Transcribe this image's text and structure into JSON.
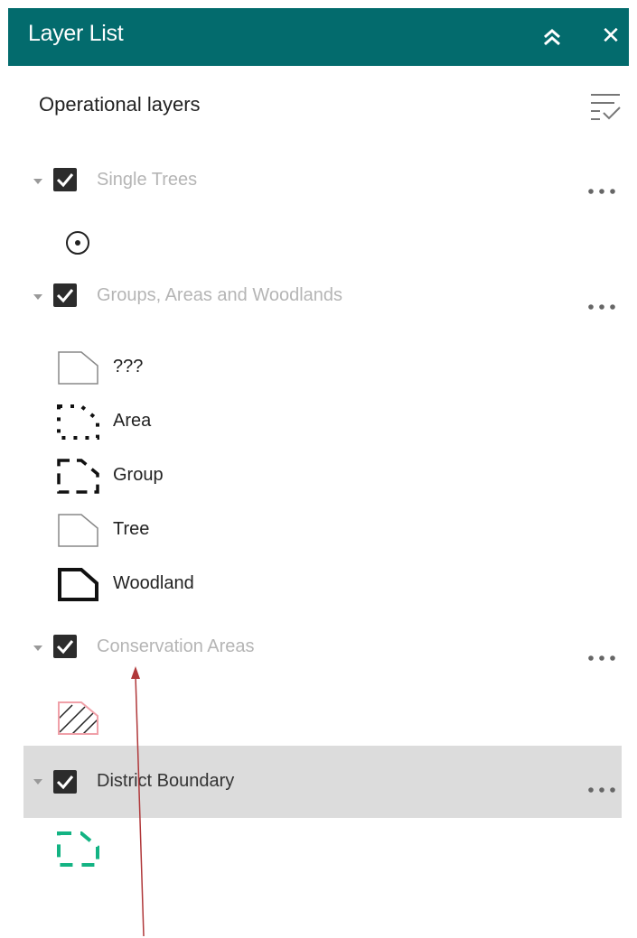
{
  "header": {
    "title": "Layer List",
    "collapse_icon": "double-chevron-up-icon",
    "close_icon": "close-icon",
    "close_glyph": "✕",
    "background": "#036b6d"
  },
  "section": {
    "title": "Operational layers",
    "tools_icon": "layer-list-options-icon"
  },
  "layers": [
    {
      "label": "Single Trees",
      "checked": true,
      "legend": [
        {
          "label": "",
          "icon": "point-circle-icon"
        }
      ]
    },
    {
      "label": "Groups, Areas and Woodlands",
      "checked": true,
      "legend": [
        {
          "label": "???",
          "icon": "polygon-thin-gray-icon"
        },
        {
          "label": "Area",
          "icon": "polygon-dotted-black-icon"
        },
        {
          "label": "Group",
          "icon": "polygon-dashed-black-icon"
        },
        {
          "label": "Tree",
          "icon": "polygon-thin-gray-icon"
        },
        {
          "label": "Woodland",
          "icon": "polygon-thick-black-icon"
        }
      ]
    },
    {
      "label": "Conservation Areas",
      "checked": true,
      "legend": [
        {
          "label": "",
          "icon": "polygon-hatched-pink-icon"
        }
      ]
    },
    {
      "label": "District Boundary",
      "checked": true,
      "selected": true,
      "legend": [
        {
          "label": "",
          "icon": "polygon-dashed-teal-icon"
        }
      ]
    }
  ],
  "colors": {
    "checkbox": "#2c2c2c",
    "dimmed_label": "#b5b5b5",
    "selected_row": "#dcdcdc",
    "boundary_teal": "#13b383",
    "annotation_arrow": "#b0383a"
  }
}
